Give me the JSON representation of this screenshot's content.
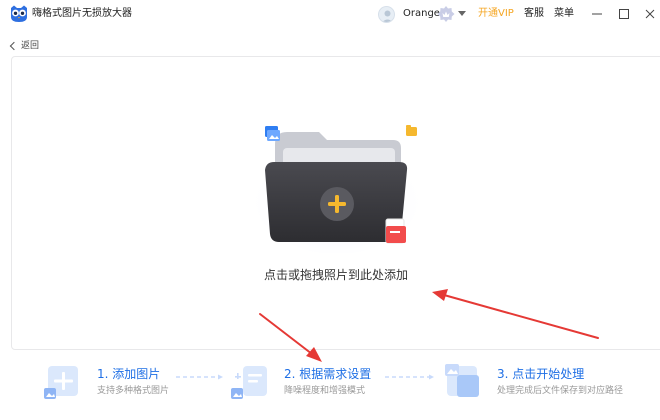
{
  "app": {
    "title": "嗨格式图片无损放大器"
  },
  "header": {
    "user_name": "Orange",
    "vip_label": "开通VIP",
    "support_label": "客服",
    "menu_label": "菜单"
  },
  "nav": {
    "back_label": "返回"
  },
  "drop_zone": {
    "hint": "点击或拖拽照片到此处添加"
  },
  "steps": [
    {
      "title": "1. 添加图片",
      "desc": "支持多种格式图片"
    },
    {
      "title": "2. 根据需求设置",
      "desc": "降噪程度和增强模式"
    },
    {
      "title": "3. 点击开始处理",
      "desc": "处理完成后文件保存到对应路径"
    }
  ],
  "colors": {
    "accent": "#1f6fe5",
    "vip": "#f5a623",
    "annotation_arrow": "#e53935",
    "folder_dark": "#3a3a3e",
    "plus_circle": "#f5b82e"
  }
}
